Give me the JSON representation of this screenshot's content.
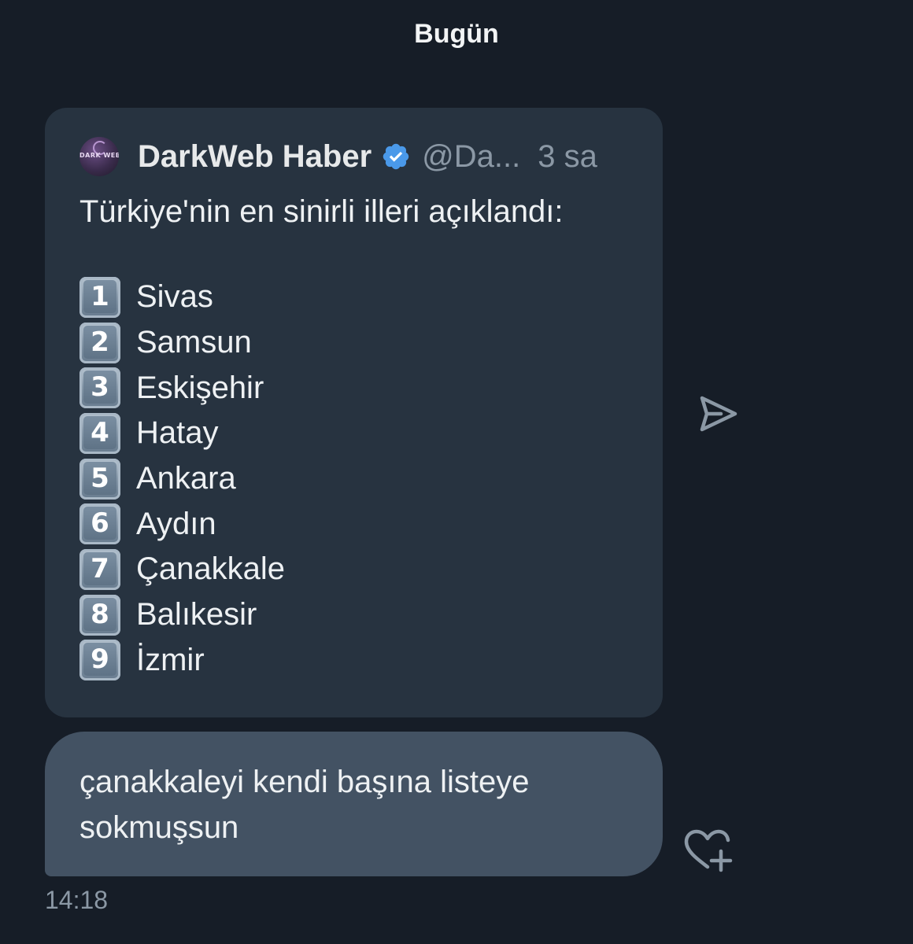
{
  "header": {
    "day_label": "Bugün"
  },
  "quoted_post": {
    "avatar_text": "DARK WEB",
    "author_name": "DarkWeb Haber",
    "handle": "@Da...",
    "time_ago": "3 sa",
    "text": "Türkiye'nin en sinirli illeri açıklandı:",
    "ranking": [
      {
        "number": "1",
        "city": "Sivas"
      },
      {
        "number": "2",
        "city": "Samsun"
      },
      {
        "number": "3",
        "city": "Eskişehir"
      },
      {
        "number": "4",
        "city": "Hatay"
      },
      {
        "number": "5",
        "city": "Ankara"
      },
      {
        "number": "6",
        "city": "Aydın"
      },
      {
        "number": "7",
        "city": "Çanakkale"
      },
      {
        "number": "8",
        "city": "Balıkesir"
      },
      {
        "number": "9",
        "city": "İzmir"
      }
    ]
  },
  "message": {
    "text": "çanakkaleyi kendi başına listeye sokmuşsun",
    "timestamp": "14:18"
  },
  "icons": {
    "verified": "verified-badge-icon",
    "share": "share-send-icon",
    "react": "heart-plus-icon"
  },
  "colors": {
    "background": "#161d27",
    "quote_card": "#273340",
    "message_bubble": "#435263",
    "verified": "#4a99e9",
    "muted_text": "#8b98a5"
  }
}
